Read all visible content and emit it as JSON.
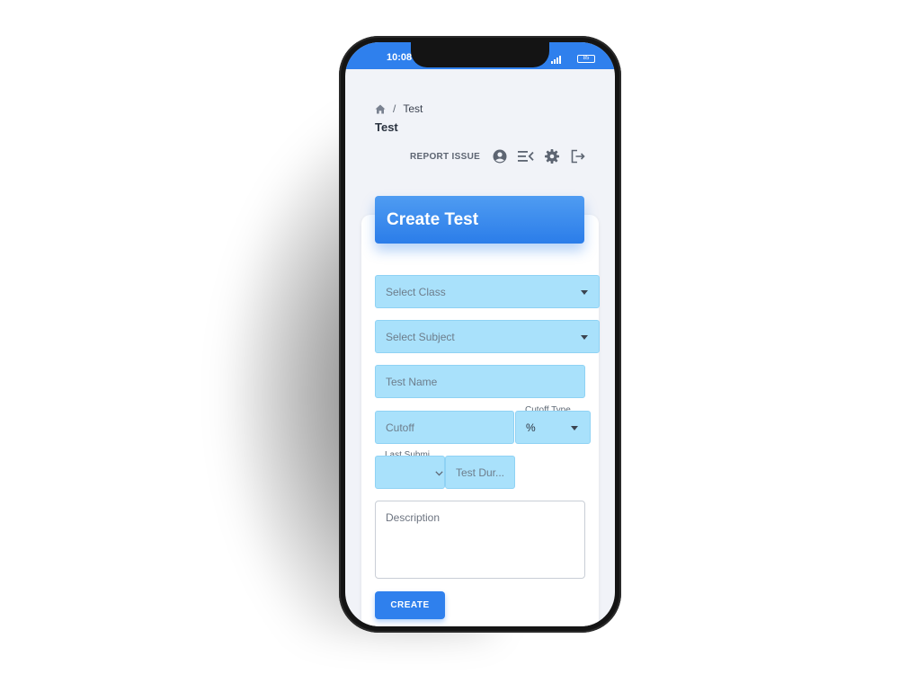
{
  "status_bar": {
    "time": "10:08",
    "battery": "85"
  },
  "breadcrumb": {
    "separator": "/",
    "current": "Test"
  },
  "page_title": "Test",
  "toolbar": {
    "report_issue": "REPORT ISSUE",
    "icons": [
      "account-icon",
      "menu-collapse-icon",
      "settings-icon",
      "logout-icon"
    ]
  },
  "card": {
    "title": "Create Test",
    "select_class_placeholder": "Select Class",
    "select_subject_placeholder": "Select Subject",
    "test_name_placeholder": "Test Name",
    "cutoff_placeholder": "Cutoff",
    "cutoff_type_label": "Cutoff Type",
    "cutoff_type_value": "%",
    "last_submission_label": "Last Submi...",
    "test_duration_placeholder": "Test Dur...",
    "description_placeholder": "Description",
    "create_label": "CREATE"
  },
  "colors": {
    "accent": "#2f80ed",
    "field_fill": "#a9e1fb",
    "background": "#f1f3f8"
  }
}
